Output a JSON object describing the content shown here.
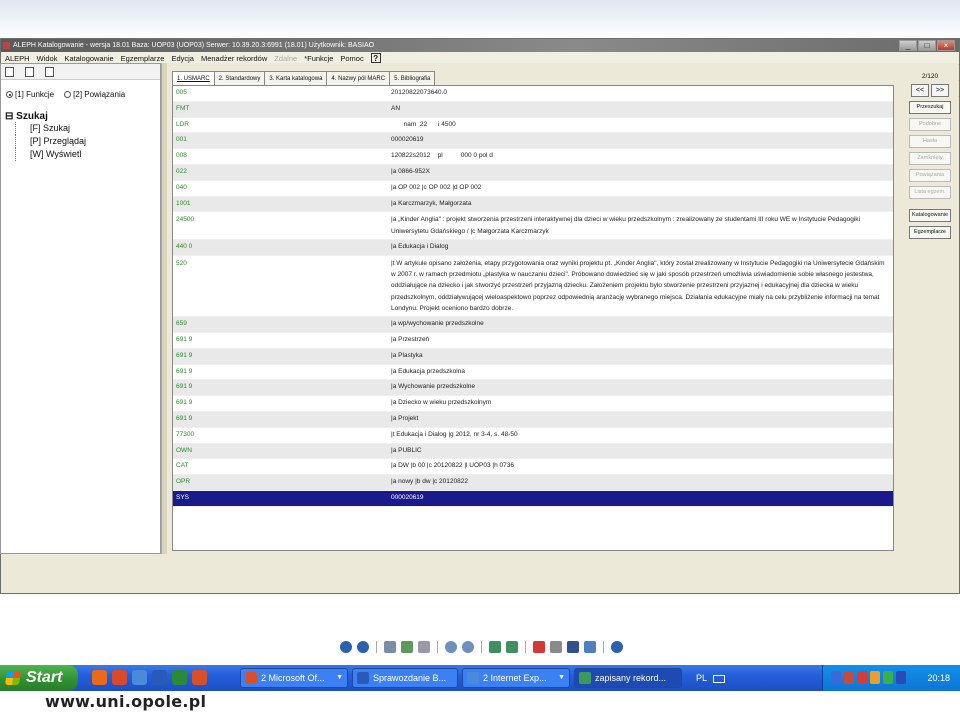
{
  "window": {
    "title": "ALEPH Katalogowanie - wersja 18.01  Baza:  UOP03 (UOP03)  Serwer:  10.39.20.3:6991 (18.01)  Użytkownik:  BASIAO",
    "controls": [
      "_",
      "□",
      "×"
    ]
  },
  "menu": {
    "items": [
      "ALEPH",
      "Widok",
      "Katalogowanie",
      "Egzemplarze",
      "Edycja",
      "Menadżer rekordów"
    ],
    "disabled_item": "Zdalne",
    "after_items": [
      "*Funkcje",
      "Pomoc"
    ],
    "help_icon": "?"
  },
  "left_panel": {
    "radio_selected": "[1] Funkcje",
    "radio_other": "[2] Powiązania",
    "tree_root": "Szukaj",
    "tree_items": [
      "[F] Szukaj",
      "[P] Przeglądaj",
      "[W] Wyświetl"
    ]
  },
  "tabs": [
    "1. USMARC",
    "2. Standardowy",
    "3. Karta katalogowa",
    "4. Nazwy pól MARC",
    "5. Bibliografia"
  ],
  "record": [
    {
      "tag": "005",
      "value": "20120822073640.0"
    },
    {
      "tag": "FMT",
      "value": "AN"
    },
    {
      "tag": "LDR",
      "value": "       nam  22      i 4500"
    },
    {
      "tag": "001",
      "value": "000020619"
    },
    {
      "tag": "008",
      "value": "120822s2012    pl          000 0 pol d"
    },
    {
      "tag": "022",
      "value": "|a 0866-952X"
    },
    {
      "tag": "040",
      "value": "|a OP 002 |c OP 002 |d OP 002"
    },
    {
      "tag": "1001",
      "value": "|a Karczmarzyk, Małgorzata"
    },
    {
      "tag": "24500",
      "value": "|a „Kinder Anglia\" : projekt stworzenia przestrzeni interaktywnej dla dzieci w wieku przedszkolnym : zrealizowany ze studentami III roku WE w Instytucie Pedagogiki Uniwersytetu Gdańskiego / |c Małgorzata Karczmarzyk"
    },
    {
      "tag": "440 0",
      "value": "|a Edukacja i Dialog"
    },
    {
      "tag": "520",
      "value": "|t W artykule opisano założenia, etapy przygotowania oraz wyniki projektu pt. „Kinder Anglia\", który został zrealizowany w Instytucie Pedagogiki na Uniwersytecie Gdańskim w 2007 r. w ramach przedmiotu „plastyka w nauczaniu dzieci\". Próbowano dowiedzieć się w jaki sposób przestrzeń umożliwia uświadomienie sobie własnego jestestwa, oddziałujące na dziecko i jak stworzyć przestrzeń przyjazną dziecku. Założeniem projektu było stworzenie przestrzeni przyjaznej i edukacyjnej dla dziecka w wieku przedszkolnym, oddziaływującej wieloaspektowo poprzez odpowiednią aranżację wybranego miejsca. Działania edukacyjne miały na celu przybliżenie informacji na temat Londynu. Projekt oceniono bardzo dobrze."
    },
    {
      "tag": "659",
      "value": "|a wp/wychowanie przedszkolne"
    },
    {
      "tag": "691 9",
      "value": "|a Przestrzeń"
    },
    {
      "tag": "691 9",
      "value": "|a Plastyka"
    },
    {
      "tag": "691 9",
      "value": "|a Edukacja przedszkolna"
    },
    {
      "tag": "691 9",
      "value": "|a Wychowanie przedszkolne"
    },
    {
      "tag": "691 9",
      "value": "|a Dziecko w wieku przedszkolnym"
    },
    {
      "tag": "691 9",
      "value": "|a Projekt"
    },
    {
      "tag": "77300",
      "value": "|t Edukacja i Dialog |g 2012, nr 3-4, s. 48-50"
    },
    {
      "tag": "OWN",
      "value": "|a PUBLIC"
    },
    {
      "tag": "CAT",
      "value": "|a DW |b 00 |c 20120822 |l UOP03 |h 0736"
    },
    {
      "tag": "OPR",
      "value": "|a nowy |b dw |c 20120822"
    },
    {
      "tag": "SYS",
      "value": "000020619"
    }
  ],
  "right_panel": {
    "counter": "2/120",
    "prev": "<<",
    "next": ">>",
    "buttons": [
      {
        "label": "Przeszukaj",
        "enabled": true
      },
      {
        "label": "Podobne",
        "enabled": false
      },
      {
        "label": "Hasła",
        "enabled": false
      },
      {
        "label": "Zamknięty",
        "enabled": false
      },
      {
        "label": "Powiązania",
        "enabled": false
      },
      {
        "label": "Lista egzem.",
        "enabled": false
      }
    ],
    "buttons2": [
      "Katalogowanie",
      "Egzemplarze"
    ]
  },
  "taskbar": {
    "start": "Start",
    "items": [
      "2 Microsoft Of...",
      "Sprawozdanie B...",
      "2 Internet Exp...",
      "zapisany rekord..."
    ],
    "language": "PL",
    "clock": "20:18"
  },
  "footer_url": "www.uni.opole.pl",
  "colors": {
    "tag_green": "#2a8a2a",
    "selected_row": "#1a1a8c",
    "taskbar_blue": "#245edb",
    "start_green": "#2f8f2f"
  }
}
